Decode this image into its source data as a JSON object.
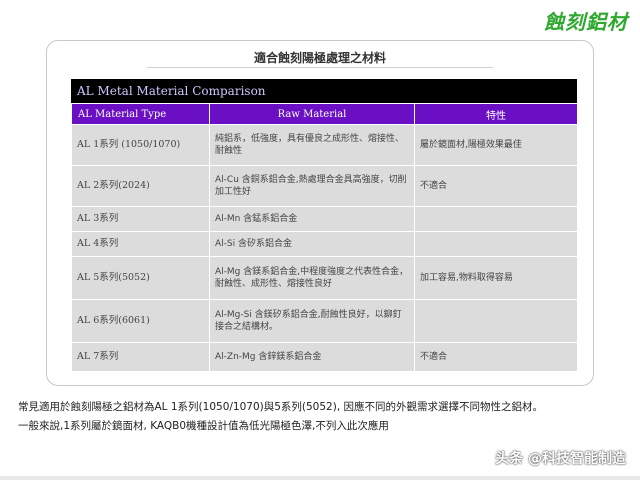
{
  "brand": "蝕刻鋁材",
  "card": {
    "title": "適合蝕刻陽極處理之材料"
  },
  "table": {
    "title": "AL Metal Material Comparison",
    "headers": [
      "AL Material Type",
      "Raw Material",
      "特性"
    ],
    "rows": [
      [
        "AL 1系列 (1050/1070)",
        "純鋁系，低強度，具有優良之成形性、熔接性、耐蝕性",
        "屬於鏡面材,陽極效果最佳"
      ],
      [
        "AL 2系列(2024)",
        "Al-Cu 含銅系鋁合金,熱處理合金具高強度，切削加工性好",
        "不適合"
      ],
      [
        "AL 3系列",
        "Al-Mn 含錳系鋁合金",
        ""
      ],
      [
        "AL 4系列",
        "Al-Si 含矽系鋁合金",
        ""
      ],
      [
        "AL 5系列(5052)",
        "Al-Mg 含鎂系鋁合金,中程度強度之代表性合金，耐蝕性、成形性、熔接性良好",
        "加工容易,物料取得容易"
      ],
      [
        "AL 6系列(6061)",
        "Al-Mg-Si 含鎂矽系鋁合金,耐蝕性良好，以鉚釘接合之結構材。",
        ""
      ],
      [
        "AL 7系列",
        "Al-Zn-Mg 含鋅鎂系鋁合金",
        "不適合"
      ]
    ]
  },
  "footer": {
    "line1": "常見適用於蝕刻陽極之鋁材為AL 1系列(1050/1070)與5系列(5052), 因應不同的外觀需求選擇不同物性之鋁材。",
    "line2": "一般來說,1系列屬於鏡面材, KAQB0機種設計值為低光陽極色澤,不列入此次應用"
  },
  "watermark": "头条 @科技智能制造"
}
